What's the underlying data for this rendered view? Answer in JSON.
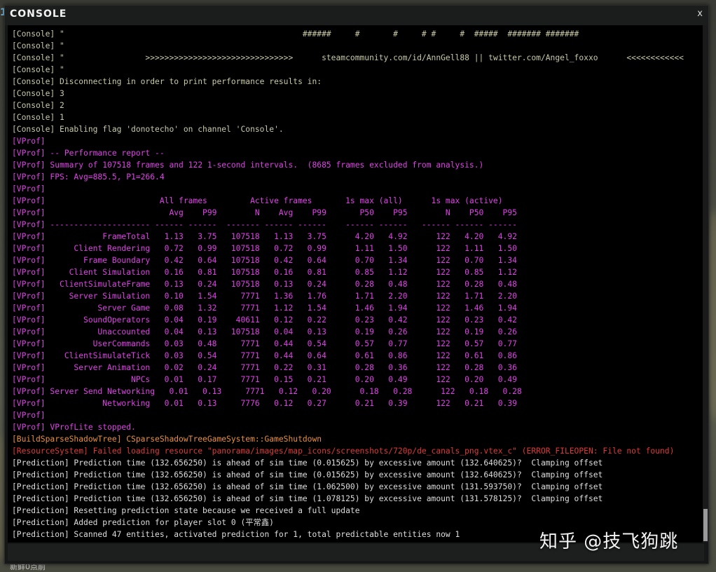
{
  "window": {
    "title": "CONSOLE",
    "close_label": "x",
    "edge_digit": "1",
    "bottom_left_text": "新鲜0点前"
  },
  "watermark": "知乎 @技飞狗跳",
  "colors": {
    "console": "#c9c9a6",
    "vprof": "#e040e8",
    "build": "#e8903a",
    "resource": "#e03838",
    "prediction": "#dedede"
  },
  "log_lines": [
    {
      "text": "[Console] \"                                                  ######     #       #     # #     #  #####  ####### #######",
      "kind": "console"
    },
    {
      "text": "[Console] \"",
      "kind": "console"
    },
    {
      "text": "[Console] \"                 >>>>>>>>>>>>>>>>>>>>>>>>>>>>>>>      steamcommunity.com/id/AnnGell88 || twitter.com/Angel_foxxo      <<<<<<<<<<<<",
      "kind": "console"
    },
    {
      "text": "[Console] \"",
      "kind": "console"
    },
    {
      "text": "[Console] Disconnecting in order to print performance results in:",
      "kind": "console"
    },
    {
      "text": "[Console] 3",
      "kind": "console"
    },
    {
      "text": "[Console] 2",
      "kind": "console"
    },
    {
      "text": "[Console] 1",
      "kind": "console"
    },
    {
      "text": "[Console] Enabling flag 'donotecho' on channel 'Console'.",
      "kind": "console"
    },
    {
      "text": "[VProf]",
      "kind": "vprof"
    },
    {
      "text": "[VProf] -- Performance report --",
      "kind": "vprof"
    },
    {
      "text": "[VProf] Summary of 107518 frames and 122 1-second intervals.  (8685 frames excluded from analysis.)",
      "kind": "vprof"
    },
    {
      "text": "[VProf] FPS: Avg=885.5, P1=266.4",
      "kind": "vprof"
    },
    {
      "text": "[VProf]",
      "kind": "vprof"
    },
    {
      "text": "[VProf]                        All frames         Active frames       1s max (all)      1s max (active)",
      "kind": "vprof"
    },
    {
      "text": "[VProf]                          Avg    P99        N    Avg    P99       P50    P95        N    P50    P95",
      "kind": "vprof"
    },
    {
      "text": "[VProf] --------------------- ------ ------  ------- ------ ------    ------ ------   ------ ------ ------",
      "kind": "vprof"
    },
    {
      "text": "[VProf]            FrameTotal   1.13   3.75   107518   1.13   3.75      4.20   4.92      122   4.20   4.92",
      "kind": "vprof"
    },
    {
      "text": "[VProf]      Client Rendering   0.72   0.99   107518   0.72   0.99      1.11   1.50      122   1.11   1.50",
      "kind": "vprof"
    },
    {
      "text": "[VProf]        Frame Boundary   0.42   0.64   107518   0.42   0.64      0.70   1.34      122   0.70   1.34",
      "kind": "vprof"
    },
    {
      "text": "[VProf]     Client Simulation   0.16   0.81   107518   0.16   0.81      0.85   1.12      122   0.85   1.12",
      "kind": "vprof"
    },
    {
      "text": "[VProf]   ClientSimulateFrame   0.13   0.24   107518   0.13   0.24      0.28   0.48      122   0.28   0.48",
      "kind": "vprof"
    },
    {
      "text": "[VProf]     Server Simulation   0.10   1.54     7771   1.36   1.76      1.71   2.20      122   1.71   2.20",
      "kind": "vprof"
    },
    {
      "text": "[VProf]           Server Game   0.08   1.32     7771   1.12   1.54      1.46   1.94      122   1.46   1.94",
      "kind": "vprof"
    },
    {
      "text": "[VProf]        SoundOperators   0.04   0.19    40611   0.12   0.22      0.23   0.42      122   0.23   0.42",
      "kind": "vprof"
    },
    {
      "text": "[VProf]           Unaccounted   0.04   0.13   107518   0.04   0.13      0.19   0.26      122   0.19   0.26",
      "kind": "vprof"
    },
    {
      "text": "[VProf]          UserCommands   0.03   0.48     7771   0.44   0.54      0.57   0.77      122   0.57   0.77",
      "kind": "vprof"
    },
    {
      "text": "[VProf]    ClientSimulateTick   0.03   0.54     7771   0.44   0.64      0.61   0.86      122   0.61   0.86",
      "kind": "vprof"
    },
    {
      "text": "[VProf]      Server Animation   0.02   0.24     7771   0.22   0.31      0.28   0.36      122   0.28   0.36",
      "kind": "vprof"
    },
    {
      "text": "[VProf]                  NPCs   0.01   0.17     7771   0.15   0.21      0.20   0.49      122   0.20   0.49",
      "kind": "vprof"
    },
    {
      "text": "[VProf] Server Send Networking   0.01   0.13     7771   0.12   0.20      0.18   0.28      122   0.18   0.28",
      "kind": "vprof"
    },
    {
      "text": "[VProf]            Networking   0.01   0.13     7776   0.12   0.27      0.21   0.39      122   0.21   0.39",
      "kind": "vprof"
    },
    {
      "text": "[VProf]",
      "kind": "vprof"
    },
    {
      "text": "[VProf] VProfLite stopped.",
      "kind": "vprof"
    },
    {
      "text": "[BuildSparseShadowTree] CSparseShadowTreeGameSystem::GameShutdown",
      "kind": "build"
    },
    {
      "text": "[ResourceSystem] Failed loading resource \"panorama/images/map_icons/screenshots/720p/de_canals_png.vtex_c\" (ERROR_FILEOPEN: File not found)",
      "kind": "resource"
    },
    {
      "text": "[Prediction] Prediction time (132.656250) is ahead of sim time (0.015625) by excessive amount (132.640625)?  Clamping offset",
      "kind": "prediction"
    },
    {
      "text": "[Prediction] Prediction time (132.656250) is ahead of sim time (0.015625) by excessive amount (132.640625)?  Clamping offset",
      "kind": "prediction"
    },
    {
      "text": "[Prediction] Prediction time (132.656250) is ahead of sim time (1.062500) by excessive amount (131.593750)?  Clamping offset",
      "kind": "prediction"
    },
    {
      "text": "[Prediction] Prediction time (132.656250) is ahead of sim time (1.078125) by excessive amount (131.578125)?  Clamping offset",
      "kind": "prediction"
    },
    {
      "text": "[Prediction] Resetting prediction state because we received a full update",
      "kind": "prediction"
    },
    {
      "text": "[Prediction] Added prediction for player slot 0 (平常鑫)",
      "kind": "prediction"
    },
    {
      "text": "[Prediction] Scanned 47 entities, activated prediction for 1, total predictable entities now 1",
      "kind": "prediction"
    }
  ]
}
